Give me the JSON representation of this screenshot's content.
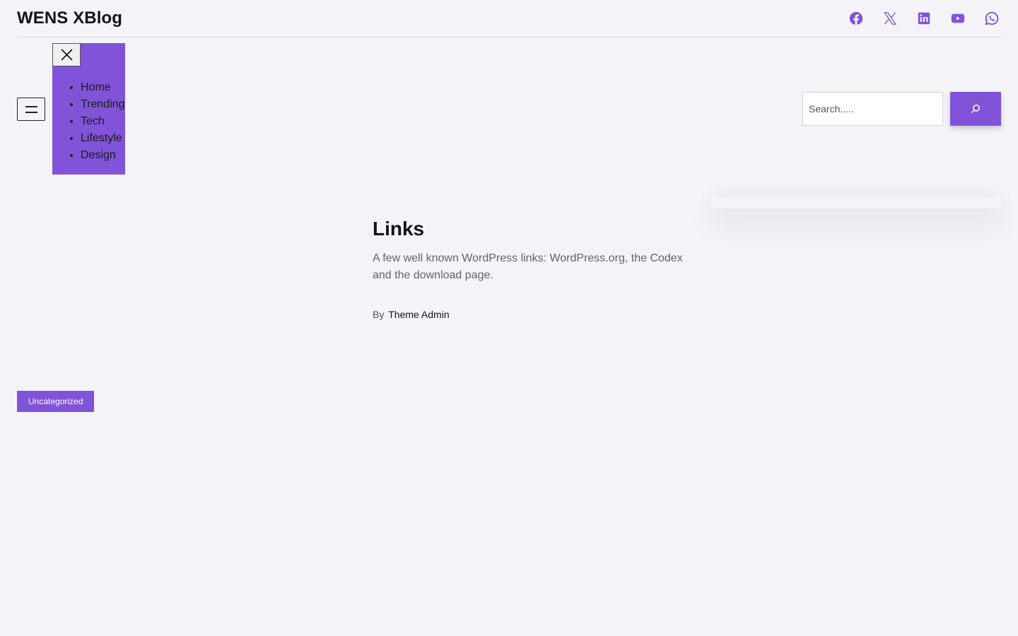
{
  "header": {
    "site_title": "WENS XBlog",
    "socials": [
      {
        "icon": "facebook-icon"
      },
      {
        "icon": "x-twitter-icon"
      },
      {
        "icon": "linkedin-icon"
      },
      {
        "icon": "youtube-icon"
      },
      {
        "icon": "whatsapp-icon"
      }
    ]
  },
  "nav": {
    "items": [
      {
        "label": "Home"
      },
      {
        "label": "Trending"
      },
      {
        "label": "Tech"
      },
      {
        "label": "Lifestyle"
      },
      {
        "label": "Design"
      }
    ]
  },
  "search": {
    "placeholder": "Search.....",
    "value": ""
  },
  "post": {
    "title": "Links",
    "excerpt": "A few well known WordPress links: WordPress.org, the Codex and the download page.",
    "byline_prefix": "By",
    "author": "Theme Admin"
  },
  "category": {
    "label": "Uncategorized"
  },
  "colors": {
    "accent": "#8053d8",
    "background": "#f4f4f8",
    "text": "#111418",
    "muted_text": "#5e6373"
  }
}
